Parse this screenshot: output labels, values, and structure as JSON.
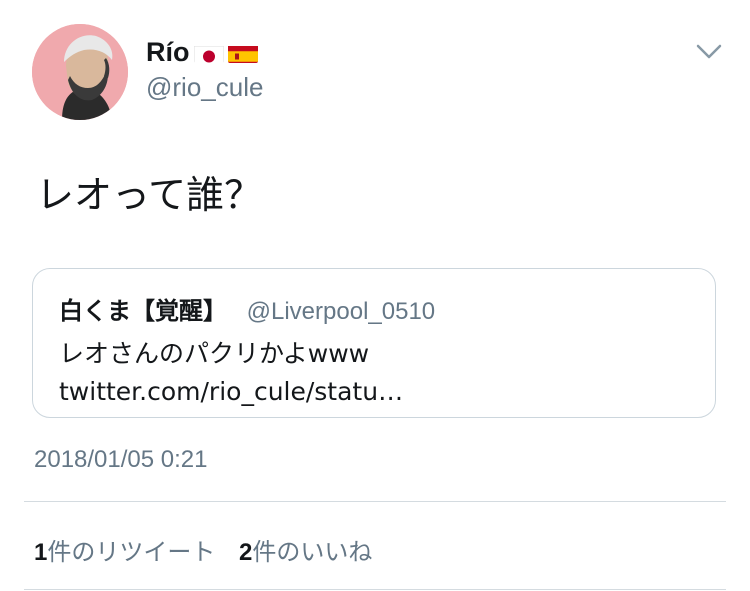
{
  "author": {
    "display_name": "Río",
    "handle": "@rio_cule",
    "flags": [
      "japan-flag-icon",
      "spain-flag-icon"
    ]
  },
  "tweet": {
    "text": "レオって誰？",
    "timestamp": "2018/01/05 0:21"
  },
  "quote": {
    "display_name": "白くま【覚醒】",
    "handle": "@Liverpool_0510",
    "text": "レオさんのパクリかよwww twitter.com/rio_cule/statu…"
  },
  "stats": {
    "retweet_count": "1",
    "retweet_label": "件のリツイート",
    "like_count": "2",
    "like_label": "件のいいね"
  },
  "colors": {
    "text_primary": "#14171a",
    "text_secondary": "#657786",
    "border": "#ccd6dd",
    "avatar_bg": "#f0a9ad"
  }
}
